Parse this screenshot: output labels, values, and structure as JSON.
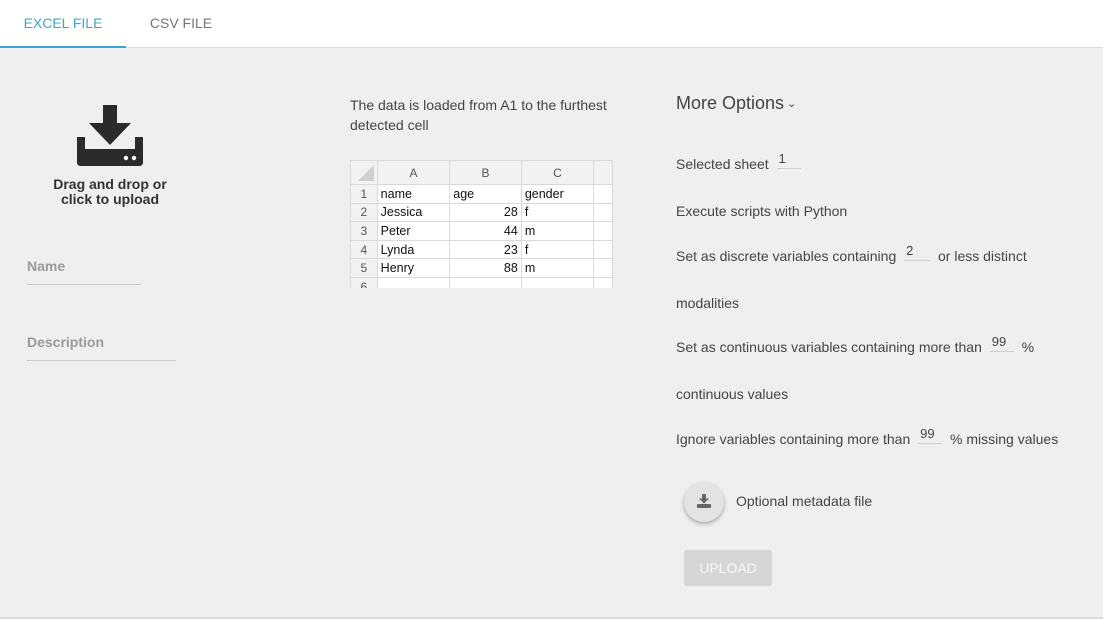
{
  "tabs": [
    {
      "label": "EXCEL FILE",
      "active": true
    },
    {
      "label": "CSV FILE",
      "active": false
    }
  ],
  "accent_color": "#3aa6d8",
  "dropzone": {
    "icon": "download-tray-icon",
    "line1": "Drag and drop or",
    "line2": "click to upload"
  },
  "fields": {
    "name_label": "Name",
    "description_label": "Description"
  },
  "info": {
    "text": "The data is loaded from A1 to the furthest detected cell"
  },
  "sheet": {
    "columns": [
      "A",
      "B",
      "C"
    ],
    "row_numbers": [
      "1",
      "2",
      "3",
      "4",
      "5",
      "6"
    ],
    "rows": [
      [
        "name",
        "age",
        "gender"
      ],
      [
        "Jessica",
        "28",
        "f"
      ],
      [
        "Peter",
        "44",
        "m"
      ],
      [
        "Lynda",
        "23",
        "f"
      ],
      [
        "Henry",
        "88",
        "m"
      ]
    ]
  },
  "options": {
    "title": "More Options",
    "selected_sheet_label": "Selected sheet",
    "selected_sheet_value": "1",
    "execute_scripts_label": "Execute scripts with Python",
    "discrete_prefix": "Set as discrete variables containing",
    "discrete_value": "2",
    "discrete_suffix": "or less distinct",
    "discrete_wrap": "modalities",
    "continuous_prefix": "Set as continuous variables containing more than",
    "continuous_value": "99",
    "continuous_suffix": "%",
    "continuous_wrap": "continuous values",
    "ignore_prefix": "Ignore variables containing more than",
    "ignore_value": "99",
    "ignore_suffix": "% missing values"
  },
  "metadata": {
    "icon": "download-icon",
    "label": "Optional metadata file"
  },
  "upload_label": "UPLOAD"
}
